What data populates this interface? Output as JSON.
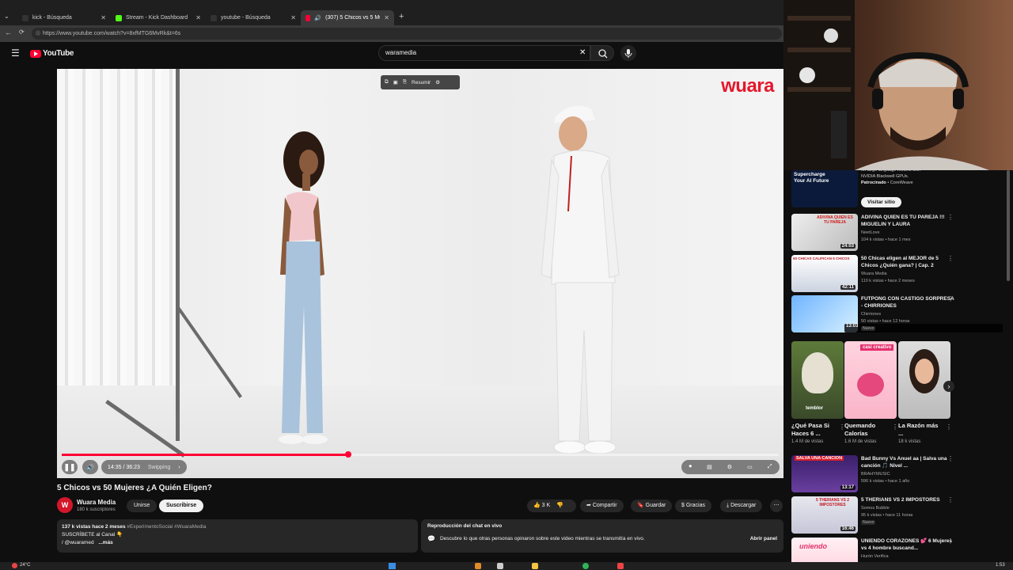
{
  "browser": {
    "tabs": [
      {
        "label": "kick - Búsqueda"
      },
      {
        "label": "Stream - Kick Dashboard"
      },
      {
        "label": "youtube - Búsqueda"
      },
      {
        "label": "(307) 5 Chicos vs 5 Mujeres"
      }
    ],
    "url": "https://www.youtube.com/watch?v=8xfMTG6MvRk&t=6s"
  },
  "header": {
    "logo": "YouTube",
    "search_value": "waramedia"
  },
  "video": {
    "brand_watermark": "wuara",
    "hover_menu": {
      "summarize": "Resumir"
    },
    "time": "14:35 / 36:23",
    "chapter": "Swipping",
    "progress": 0.4
  },
  "meta": {
    "title": "5 Chicos vs 50 Mujeres ¿A Quién Eligen?",
    "channel": "Wuara Media",
    "avatar_letter": "W",
    "subscribers": "180 k suscriptores",
    "join": "Unirse",
    "subscribe": "Suscribirse",
    "likes": "3 K",
    "share": "Compartir",
    "save": "Guardar",
    "thanks": "Gracias",
    "download": "Descargar"
  },
  "description": {
    "stats": "137 k vistas  hace 2 meses",
    "hashtags": "#ExperimentoSocial #WuaraMedia",
    "line1": "SUSCRÍBETE al Canal 👇",
    "line2": "/ @wuaramed",
    "more": "...más"
  },
  "chat": {
    "title": "Reproducción del chat en vivo",
    "body": "Descubre lo que otras personas opinaron sobre este video mientras se transmitía en vivo.",
    "open": "Abrir panel"
  },
  "ad": {
    "title_lines": [
      "Supercharge",
      "Your AI Future"
    ],
    "desc1": "for large language models with",
    "desc2": "NVIDIA Blackwell GPUs.",
    "sponsored": "Patrocinado",
    "advertiser": "CoreWeave",
    "cta": "Visitar sitio"
  },
  "recs": [
    {
      "title": "ADIVINA QUIEN ES TU PAREJA !!! MIGUELIN Y LAURA",
      "channel": "NeetLove",
      "meta": "104 k vistas • hace 1 mes",
      "duration": "24:03",
      "badge": ""
    },
    {
      "title": "50 Chicas eligen al MEJOR de 5 Chicos ¿Quién gana? | Cap. 2",
      "channel": "Wuara Media",
      "meta": "110 k vistas • hace 2 meses",
      "duration": "42:11",
      "badge": ""
    },
    {
      "title": "FUTPONG CON CASTIGO SORPRESA - CHIRRIONES",
      "channel": "Chirriones",
      "meta": "50 vistas • hace 12 horas",
      "duration": "13:03",
      "badge": "Nuevo"
    },
    {
      "title": "Bad Bunny Vs Anuel aa | Salva una canción 🎵 Nivel ...",
      "channel": "BRAHYMUSIC",
      "meta": "596 k vistas • hace 1 año",
      "duration": "13:17",
      "badge": ""
    },
    {
      "title": "5 THERIANS VS 2 IMPOSTORES",
      "channel": "Somos Bubble",
      "meta": "95 k vistas • hace 11 horas",
      "duration": "16:46",
      "badge": "Nuevo"
    },
    {
      "title": "UNIENDO CORAZONES 💕 6 Mujeres vs 4 hombre buscand...",
      "channel": "Hurón Verifica",
      "meta": "",
      "duration": "",
      "badge": ""
    }
  ],
  "shorts": [
    {
      "title": "¿Qué Pasa Si Haces 6 ...",
      "meta": "1.4 M de vistas",
      "tag": "temblor"
    },
    {
      "title": "Quemando Calorías",
      "meta": "1.6 M de vistas",
      "tag": "casi creativo"
    },
    {
      "title": "La Razón más ...",
      "meta": "18 k vistas",
      "tag": ""
    }
  ],
  "thumb_text": {
    "rec1": "ADIVINA QUIEN ES TU PAREJA",
    "rec2": "50 CHICAS CALIFICAN 5 CHICOS",
    "rec4": "SALVA UNA CANCION",
    "rec5": "5 THERIANS VS 2 IMPOSTORES",
    "rec6": "uniendo"
  },
  "taskbar": {
    "temp": "24°C",
    "time": "1:53"
  },
  "colors": {
    "accent": "#ff0033",
    "brand": "#e4182c"
  }
}
